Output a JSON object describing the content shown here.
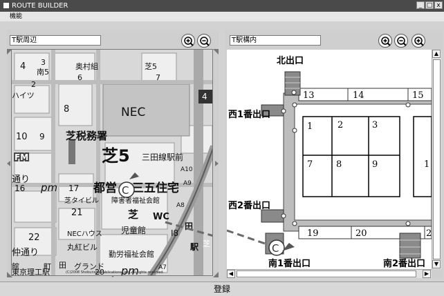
{
  "window": {
    "title": "ROUTE BUILDER",
    "buttons": [
      "_",
      "□",
      "x"
    ]
  },
  "menu": {
    "items": [
      "機能"
    ]
  },
  "left_panel": {
    "field_value": "T駅周辺"
  },
  "right_panel": {
    "field_value": "T駅構内"
  },
  "map": {
    "labels": [
      "4",
      "3",
      "南5",
      "奥村組",
      "芝5",
      "7",
      "6",
      "2",
      "ハイツ",
      "8",
      "NEC",
      "10",
      "9",
      "芝税務署",
      "芝5",
      "三田線駅前",
      "A10",
      "FM",
      "通り",
      "16",
      "pm",
      "17",
      "都営",
      "三五住宅",
      "芝タイビル",
      "障害者福祉会館",
      "21",
      "芝",
      "WC",
      "22",
      "NECハウス",
      "児童館",
      "仲通り",
      "丸紅ビル",
      "勤労福祉会館",
      "田",
      "館",
      "町",
      "グランド",
      "東京理工駅",
      "20",
      "pm",
      "A7",
      "A8",
      "A9",
      "I8",
      "田",
      "駅",
      "4",
      "芝"
    ],
    "copyright": "(C)2008 Shobunsha Publications, Inc. All rights reserved."
  },
  "station": {
    "exits": [
      "北出口",
      "西1番出口",
      "西2番出口",
      "南1番出口",
      "南2番出口"
    ],
    "cells": [
      "13",
      "14",
      "15",
      "1",
      "2",
      "3",
      "7",
      "8",
      "9",
      "1",
      "19",
      "20",
      "2"
    ]
  },
  "marker": "C",
  "save_label": "登録"
}
